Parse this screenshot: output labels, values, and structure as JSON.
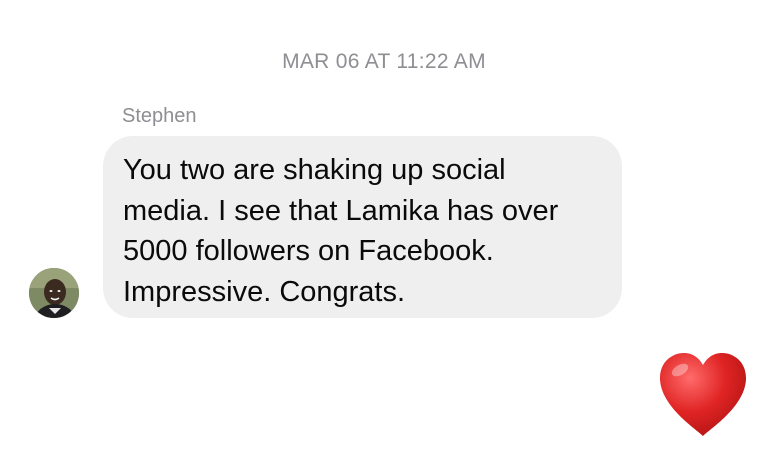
{
  "conversation": {
    "timestamp": "MAR 06 AT 11:22 AM",
    "messages": [
      {
        "sender": "Stephen",
        "text": "You two are shaking up social\nmedia. I see that Lamika has over\n5000 followers on Facebook.\nImpressive. Congrats.",
        "avatar_icon": "user-avatar-photo",
        "bubble_color": "#efefef"
      }
    ],
    "reaction": {
      "icon": "red-heart-icon",
      "color": "#dd2222"
    }
  }
}
